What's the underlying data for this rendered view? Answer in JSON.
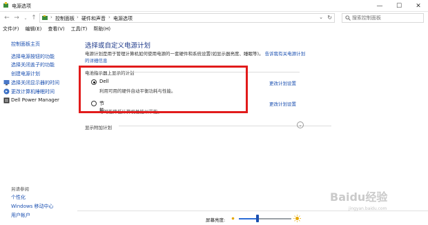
{
  "window": {
    "title": "电源选项",
    "minimize": "—",
    "maximize": "☐",
    "close": "✕"
  },
  "address": {
    "crumbs": [
      "控制面板",
      "硬件和声音",
      "电源选项"
    ],
    "search_placeholder": "搜索控制面板"
  },
  "menu": [
    "文件(F)",
    "编辑(E)",
    "查看(V)",
    "工具(T)",
    "帮助(H)"
  ],
  "sidebar": {
    "home": "控制面板主页",
    "links": [
      "选择电源按钮的功能",
      "选择关闭盖子的功能",
      "创建电源计划",
      "选择关闭显示器的时间",
      "更改计算机睡眠时间",
      "Dell Power Manager"
    ],
    "see_also_title": "另请参阅",
    "see_also": [
      "个性化",
      "Windows 移动中心",
      "用户帐户"
    ]
  },
  "main": {
    "title": "选择或自定义电源计划",
    "intro_text": "电源计划是用于管理计算机如何使用电源的一套硬件和系统设置(如显示器亮度、睡眠等)。",
    "intro_link_1": "告诉我有关电源计划",
    "intro_link_2": "的详细信息",
    "group_label": "电池指示器上显示的计划",
    "plans": [
      {
        "name": "Dell",
        "desc": "利用可用的硬件自动平衡功耗与性能。",
        "link": "更改计划设置",
        "selected": true
      },
      {
        "name": "节能",
        "desc": "尽可能降低计算机性能以节能。",
        "link": "更改计划设置",
        "selected": false
      }
    ],
    "more_plans_label": "显示附加计划"
  },
  "statusbar": {
    "brightness_label": "屏幕亮度:",
    "brightness_level": 0.35
  },
  "watermark": {
    "text": "Baidu经验",
    "sub": "jingyan.baidu.com"
  },
  "colors": {
    "link": "#1a4fb0",
    "title": "#1e3a8a",
    "highlight": "#e11b1b"
  }
}
